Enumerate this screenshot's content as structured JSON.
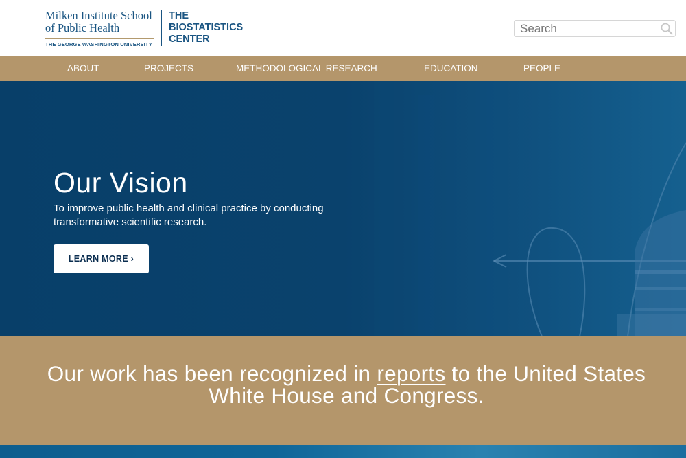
{
  "header": {
    "school_line1": "Milken Institute School",
    "school_line2": "of Public Health",
    "university": "THE GEORGE WASHINGTON UNIVERSITY",
    "center_line1": "THE",
    "center_line2": "BIOSTATISTICS",
    "center_line3": "CENTER",
    "search_placeholder": "Search"
  },
  "nav": {
    "items": [
      {
        "label": "ABOUT"
      },
      {
        "label": "PROJECTS"
      },
      {
        "label": "METHODOLOGICAL RESEARCH"
      },
      {
        "label": "EDUCATION"
      },
      {
        "label": "PEOPLE"
      }
    ]
  },
  "hero": {
    "title": "Our Vision",
    "subtitle": "To improve public health and clinical practice by conducting transformative scientific research.",
    "button_label": "LEARN MORE ›"
  },
  "recognition": {
    "prefix": "Our work has been recognized in ",
    "link": "reports",
    "suffix": " to the United States White House and Congress."
  },
  "colors": {
    "brand_blue": "#1a5582",
    "nav_gold": "#b4966b",
    "hero_navy": "#08406a"
  }
}
